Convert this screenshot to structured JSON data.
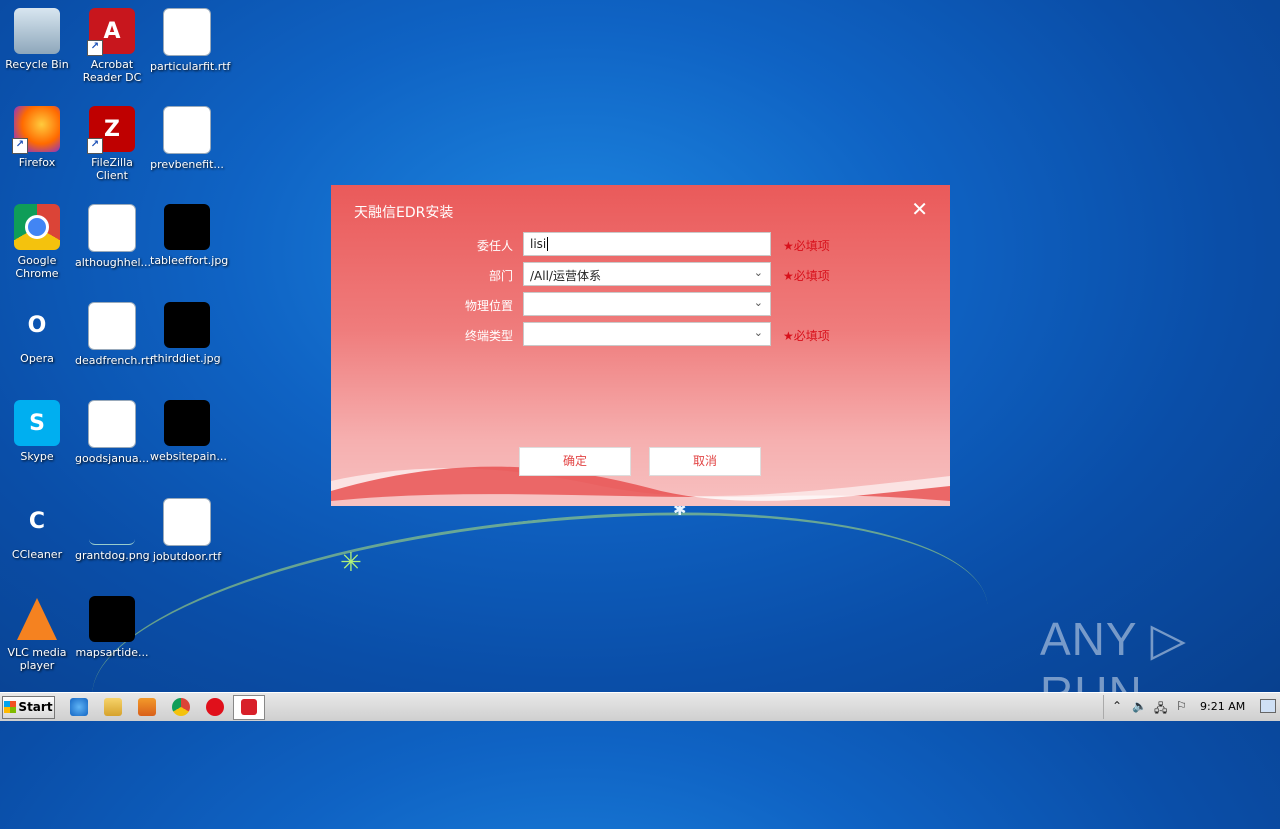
{
  "desktop": {
    "icons": [
      {
        "label": "Recycle Bin"
      },
      {
        "label": "Acrobat Reader DC"
      },
      {
        "label": "particularfit.rtf"
      },
      {
        "label": "Firefox"
      },
      {
        "label": "FileZilla Client"
      },
      {
        "label": "prevbenefit..."
      },
      {
        "label": "Google Chrome"
      },
      {
        "label": "althoughhel..."
      },
      {
        "label": "tableeffort.jpg"
      },
      {
        "label": "Opera"
      },
      {
        "label": "deadfrench.rtf"
      },
      {
        "label": "thirddiet.jpg"
      },
      {
        "label": "Skype"
      },
      {
        "label": "goodsjanua..."
      },
      {
        "label": "websitepain..."
      },
      {
        "label": "CCleaner"
      },
      {
        "label": "grantdog.png"
      },
      {
        "label": "jobutdoor.rtf"
      },
      {
        "label": "VLC media player"
      },
      {
        "label": "mapsartide..."
      }
    ],
    "watermark": "ANY ▷ RUN"
  },
  "dialog": {
    "title": "天融信EDR安装",
    "fields": [
      {
        "label": "委任人",
        "value": "lisi",
        "required_text": "必填项"
      },
      {
        "label": "部门",
        "value": "/All/运营体系",
        "required_text": "必填项"
      },
      {
        "label": "物理位置",
        "value": "",
        "required_text": ""
      },
      {
        "label": "终端类型",
        "value": "",
        "required_text": "必填项"
      }
    ],
    "ok_label": "确定",
    "cancel_label": "取消"
  },
  "taskbar": {
    "start_label": "Start",
    "clock": "9:21 AM"
  },
  "colors": {
    "dialog_top": "#ea5a5a",
    "required_text": "#d8101b",
    "button_text": "#e24545"
  }
}
